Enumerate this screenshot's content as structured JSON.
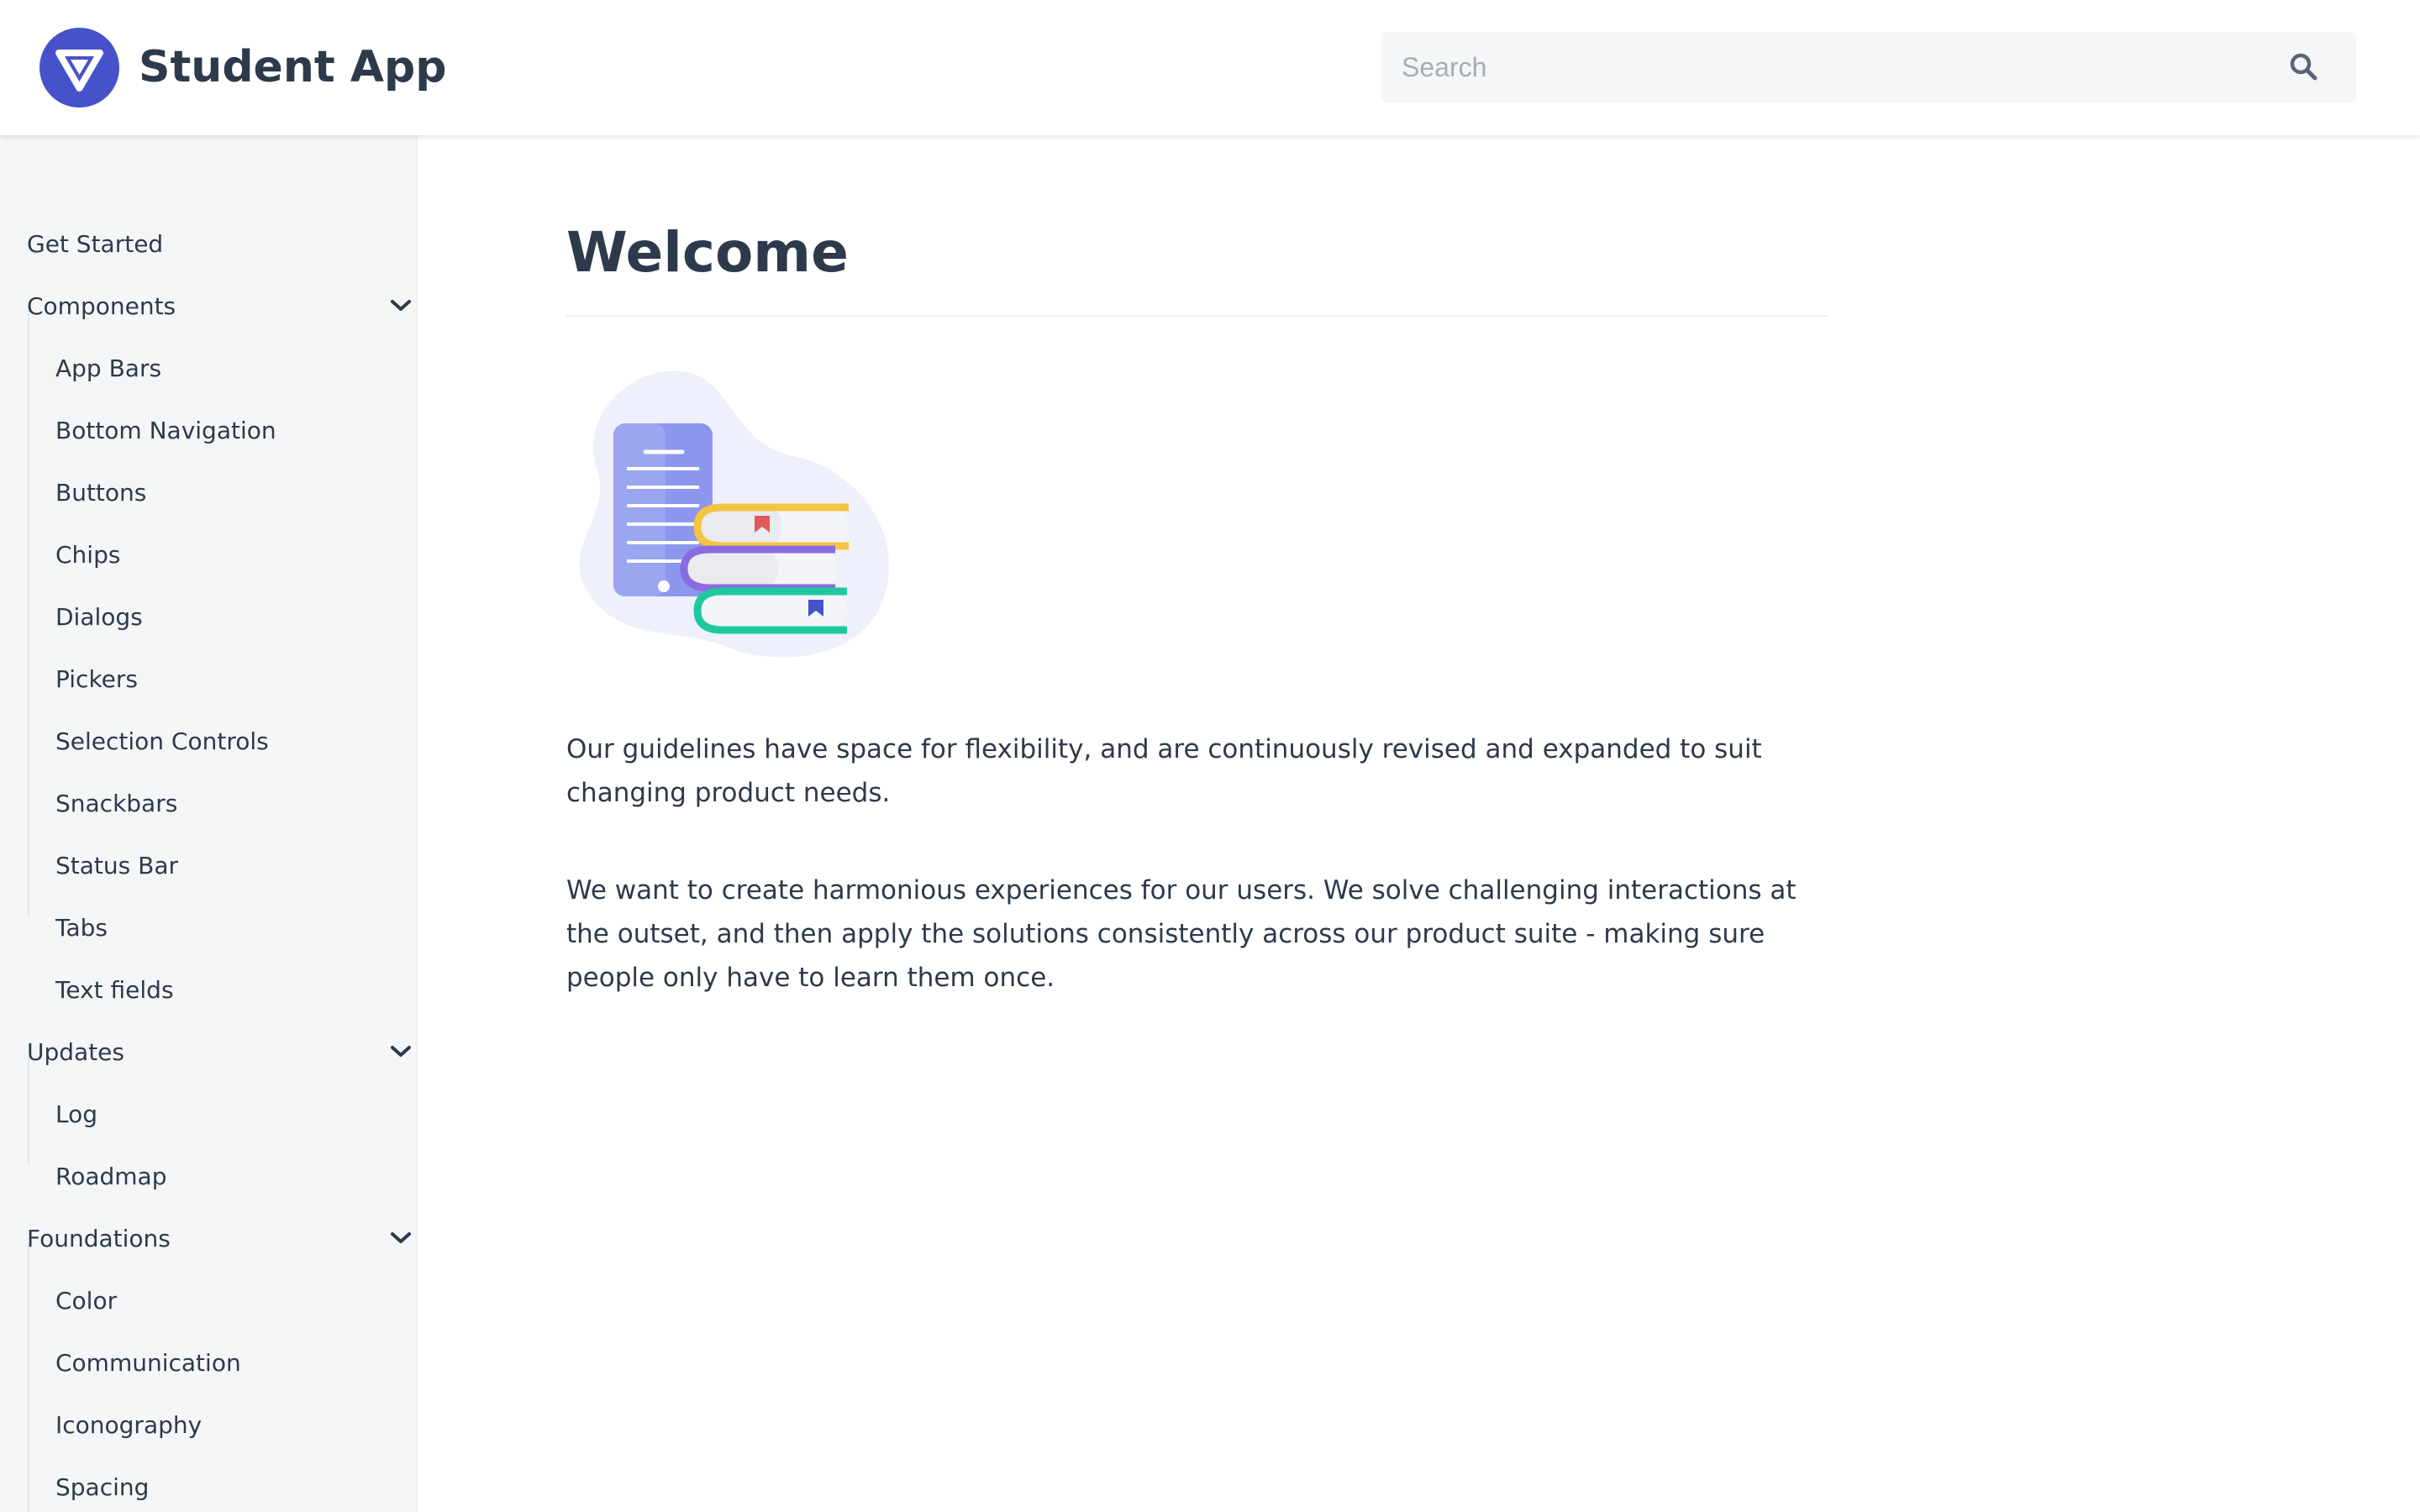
{
  "header": {
    "app_title": "Student App",
    "search_placeholder": "Search",
    "search_value": ""
  },
  "sidebar": {
    "items": [
      {
        "label": "Get Started"
      },
      {
        "label": "Components"
      },
      {
        "label": "App Bars"
      },
      {
        "label": "Bottom Navigation"
      },
      {
        "label": "Buttons"
      },
      {
        "label": "Chips"
      },
      {
        "label": "Dialogs"
      },
      {
        "label": "Pickers"
      },
      {
        "label": "Selection Controls"
      },
      {
        "label": "Snackbars"
      },
      {
        "label": "Status Bar"
      },
      {
        "label": "Tabs"
      },
      {
        "label": "Text fields"
      },
      {
        "label": "Updates"
      },
      {
        "label": "Log"
      },
      {
        "label": "Roadmap"
      },
      {
        "label": "Foundations"
      },
      {
        "label": "Color"
      },
      {
        "label": "Communication"
      },
      {
        "label": "Iconography"
      },
      {
        "label": "Spacing"
      }
    ]
  },
  "main": {
    "title": "Welcome",
    "paragraphs": [
      "Our guidelines have space for flexibility, and are continuously revised and expanded to suit changing product needs.",
      "We want to create harmonious experiences for our users. We solve challenging interactions at the outset, and then apply the solutions consistently across our product suite - making sure people only have to learn them once."
    ]
  },
  "colors": {
    "brand": "#4652c9",
    "text": "#2d3a4b",
    "sidebar_bg": "#f5f6f7",
    "book_yellow": "#f4c542",
    "book_purple": "#8a6ce0",
    "book_green": "#1ec8a0",
    "bookmark_red": "#e05a5a"
  },
  "icons": {
    "logo": "triangle-logo-icon",
    "search": "search-icon",
    "chevron": "chevron-down-icon"
  }
}
